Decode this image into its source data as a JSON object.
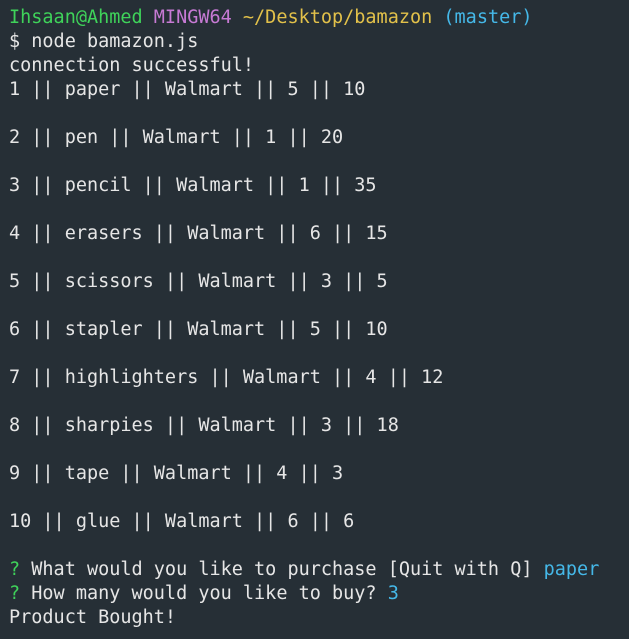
{
  "prompt": {
    "user_host": "Ihsaan@Ahmed",
    "system": "MINGW64",
    "path": "~/Desktop/bamazon",
    "branch": "(master)"
  },
  "command": "$ node bamazon.js",
  "connection_message": "connection successful!",
  "products": [
    "1 || paper || Walmart || 5 || 10",
    "2 || pen || Walmart || 1 || 20",
    "3 || pencil || Walmart || 1 || 35",
    "4 || erasers || Walmart || 6 || 15",
    "5 || scissors || Walmart || 3 || 5",
    "6 || stapler || Walmart || 5 || 10",
    "7 || highlighters || Walmart || 4 || 12",
    "8 || sharpies || Walmart || 3 || 18",
    "9 || tape || Walmart || 4 || 3",
    "10 || glue || Walmart || 6 || 6"
  ],
  "questions": [
    {
      "mark": "?",
      "text": "What would you like to purchase [Quit with Q]",
      "answer": "paper"
    },
    {
      "mark": "?",
      "text": "How many would you like to buy?",
      "answer": "3"
    }
  ],
  "result_message": "Product Bought!",
  "colors": {
    "background": "#262f36",
    "text": "#e6e6e6",
    "user": "#3fd35a",
    "system": "#c77ad4",
    "path": "#e2c14a",
    "branch": "#45b8e8"
  }
}
